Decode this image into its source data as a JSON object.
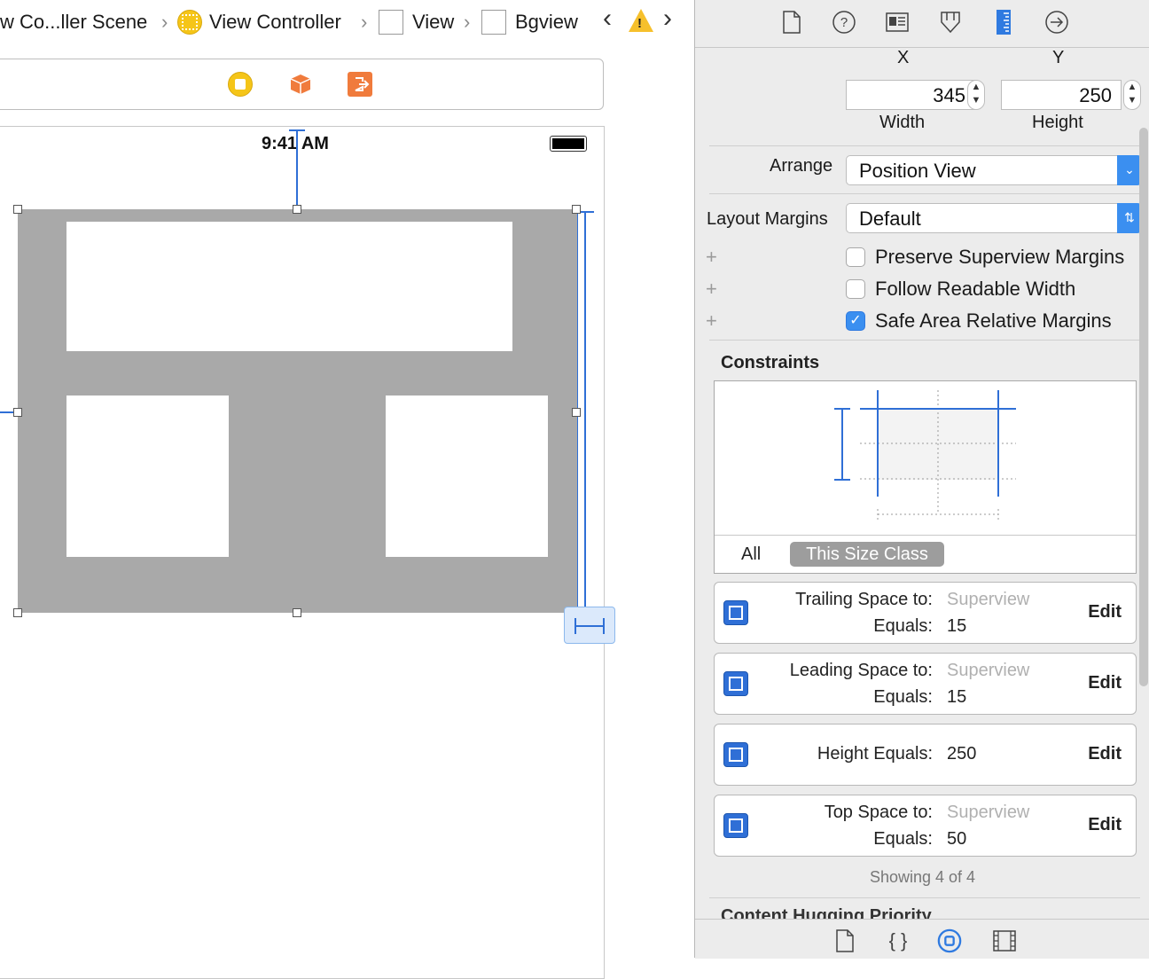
{
  "breadcrumb": {
    "scene": "w Co...ller Scene",
    "controller": "View Controller",
    "view": "View",
    "bgview": "Bgview",
    "warning_glyph": "!"
  },
  "device": {
    "status_time": "9:41 AM"
  },
  "inspector": {
    "labels": {
      "x": "X",
      "y": "Y",
      "width": "Width",
      "height": "Height"
    },
    "width_value": "345",
    "height_value": "250",
    "arrange_label": "Arrange",
    "arrange_value": "Position View",
    "layout_margins_label": "Layout Margins",
    "layout_margins_value": "Default",
    "checkboxes": [
      {
        "label": "Preserve Superview Margins",
        "checked": false
      },
      {
        "label": "Follow Readable Width",
        "checked": false
      },
      {
        "label": "Safe Area Relative Margins",
        "checked": true
      }
    ],
    "constraints_title": "Constraints",
    "segment_all": "All",
    "segment_size_class": "This Size Class",
    "constraints": [
      {
        "key1": "Trailing Space to:",
        "val1": "Superview",
        "key2": "Equals:",
        "val2": "15",
        "edit": "Edit"
      },
      {
        "key1": "Leading Space to:",
        "val1": "Superview",
        "key2": "Equals:",
        "val2": "15",
        "edit": "Edit"
      },
      {
        "key": "Height Equals:",
        "val": "250",
        "edit": "Edit"
      },
      {
        "key1": "Top Space to:",
        "val1": "Superview",
        "key2": "Equals:",
        "val2": "50",
        "edit": "Edit"
      }
    ],
    "showing": "Showing 4 of 4",
    "clipped_section": "Content Hugging Priority"
  },
  "colors": {
    "accent": "#3b8ff0",
    "constraint_blue": "#2f6fd6",
    "bgview_gray": "#a9a9a9",
    "vc_yellow": "#f5c518",
    "object_orange": "#f07b3c"
  },
  "icons": {
    "inspector_tabs": [
      "file-icon",
      "help-icon",
      "identity-icon",
      "attributes-icon",
      "size-ruler-icon",
      "connections-arrow-icon"
    ],
    "bottom_tabs": [
      "file-template-icon",
      "code-braces-icon",
      "object-library-icon",
      "media-library-icon"
    ]
  }
}
